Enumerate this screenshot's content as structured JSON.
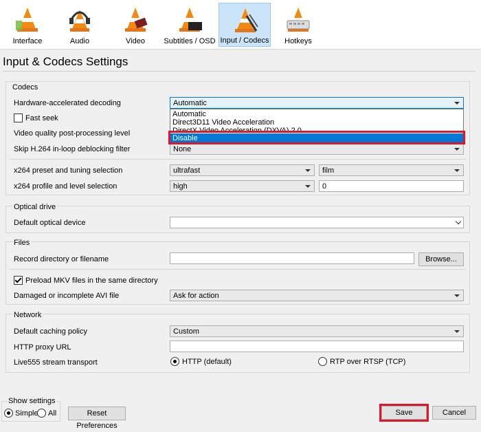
{
  "tabs": [
    {
      "label": "Interface",
      "icon": "interface-cone-icon"
    },
    {
      "label": "Audio",
      "icon": "audio-headphones-cone-icon"
    },
    {
      "label": "Video",
      "icon": "video-cone-icon"
    },
    {
      "label": "Subtitles / OSD",
      "icon": "subtitles-cone-icon"
    },
    {
      "label": "Input / Codecs",
      "icon": "input-codecs-cone-icon",
      "active": true
    },
    {
      "label": "Hotkeys",
      "icon": "hotkeys-cone-icon"
    }
  ],
  "page_title": "Input & Codecs Settings",
  "codecs": {
    "title": "Codecs",
    "hw_decoding_label": "Hardware-accelerated decoding",
    "hw_decoding_value": "Automatic",
    "hw_decoding_options": [
      "Automatic",
      "Direct3D11 Video Acceleration",
      "DirectX Video Acceleration (DXVA) 2.0",
      "Disable"
    ],
    "hw_decoding_highlighted": "Disable",
    "fast_seek_label": "Fast seek",
    "fast_seek_checked": false,
    "pp_level_label": "Video quality post-processing level",
    "skip_h264_label": "Skip H.264 in-loop deblocking filter",
    "skip_h264_value": "None",
    "x264_preset_label": "x264 preset and tuning selection",
    "x264_preset_value": "ultrafast",
    "x264_tune_value": "film",
    "x264_profile_label": "x264 profile and level selection",
    "x264_profile_value": "high",
    "x264_level_value": "0"
  },
  "optical": {
    "title": "Optical drive",
    "device_label": "Default optical device",
    "device_value": ""
  },
  "files": {
    "title": "Files",
    "record_label": "Record directory or filename",
    "record_value": "",
    "browse_label": "Browse...",
    "preload_mkv_label": "Preload MKV files in the same directory",
    "preload_mkv_checked": true,
    "avi_label": "Damaged or incomplete AVI file",
    "avi_value": "Ask for action"
  },
  "network": {
    "title": "Network",
    "caching_label": "Default caching policy",
    "caching_value": "Custom",
    "proxy_label": "HTTP proxy URL",
    "proxy_value": "",
    "live555_label": "Live555 stream transport",
    "transport_http": "HTTP (default)",
    "transport_rtsp": "RTP over RTSP (TCP)",
    "transport_selected": "HTTP (default)"
  },
  "footer": {
    "show_settings_label": "Show settings",
    "simple_label": "Simple",
    "all_label": "All",
    "selected": "Simple",
    "reset_label": "Reset Preferences",
    "save_label": "Save",
    "cancel_label": "Cancel"
  },
  "colors": {
    "highlight": "#e0162b",
    "selection": "#0078d7",
    "active_tab": "#cce4f7"
  }
}
